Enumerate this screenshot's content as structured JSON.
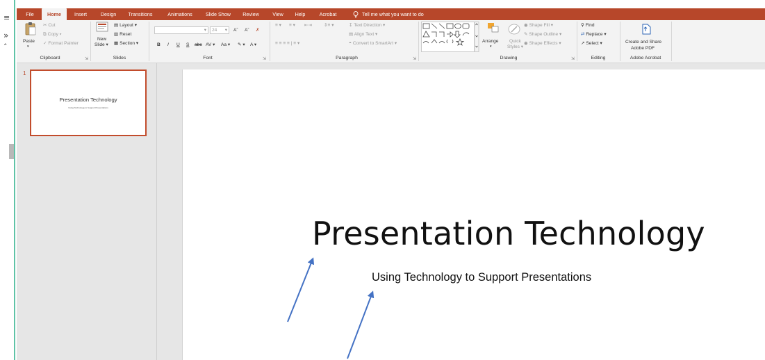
{
  "app": {
    "accent": "#B7472A",
    "ribbon_bg": "#F3F3F3",
    "canvas_bg": "#E6E6E6"
  },
  "tabs": [
    {
      "label": "File"
    },
    {
      "label": "Home",
      "active": true
    },
    {
      "label": "Insert"
    },
    {
      "label": "Design"
    },
    {
      "label": "Transitions"
    },
    {
      "label": "Animations"
    },
    {
      "label": "Slide Show"
    },
    {
      "label": "Review"
    },
    {
      "label": "View"
    },
    {
      "label": "Help"
    },
    {
      "label": "Acrobat"
    }
  ],
  "tell_me": {
    "icon": "lightbulb-icon",
    "text": "Tell me what you want to do"
  },
  "ribbon": {
    "clipboard": {
      "paste": "Paste",
      "cut": "Cut",
      "copy": "Copy",
      "format_painter": "Format Painter",
      "label": "Clipboard"
    },
    "slides": {
      "new_slide_1": "New",
      "new_slide_2": "Slide",
      "layout": "Layout",
      "reset": "Reset",
      "section": "Section",
      "label": "Slides"
    },
    "font": {
      "size": "24",
      "label": "Font",
      "bold": "B",
      "italic": "I",
      "underline": "U",
      "shadow": "S",
      "strike": "abc",
      "spacing": "AV",
      "case": "Aa",
      "color": "A"
    },
    "paragraph": {
      "text_direction": "Text Direction",
      "align_text": "Align Text",
      "convert_smartart": "Convert to SmartArt",
      "label": "Paragraph"
    },
    "drawing": {
      "arrange": "Arrange",
      "quick_styles_1": "Quick",
      "quick_styles_2": "Styles",
      "shape_fill": "Shape Fill",
      "shape_outline": "Shape Outline",
      "shape_effects": "Shape Effects",
      "label": "Drawing"
    },
    "editing": {
      "find": "Find",
      "replace": "Replace",
      "select": "Select",
      "label": "Editing"
    },
    "acrobat": {
      "create_1": "Create and Share",
      "create_2": "Adobe PDF",
      "label": "Adobe Acrobat"
    }
  },
  "thumbnails": [
    {
      "number": "1",
      "title": "Presentation Technology",
      "subtitle": "Using Technology to Support Presentations"
    }
  ],
  "slide": {
    "title": "Presentation Technology",
    "subtitle": "Using Technology to Support Presentations"
  },
  "left_strip": {
    "icons": [
      "menu-icon",
      "expand-icon",
      "collapse-icon"
    ]
  }
}
